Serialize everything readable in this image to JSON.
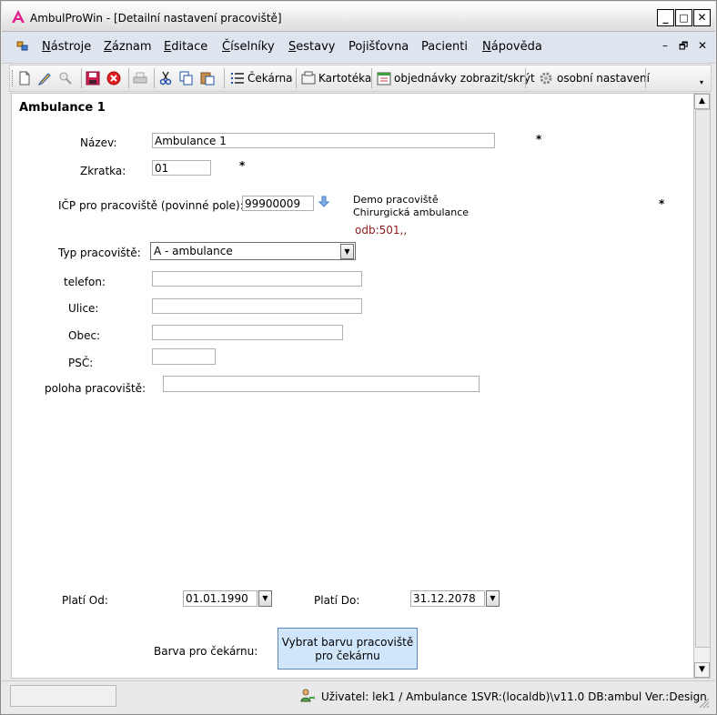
{
  "window": {
    "title": "AmbulProWin  - [Detailní nastavení pracoviště]",
    "controls": {
      "minimize": "_",
      "maximize": "□",
      "close": "✕"
    }
  },
  "menu": {
    "items": [
      {
        "first": "N",
        "rest": "ástroje"
      },
      {
        "first": "Z",
        "rest": "áznam"
      },
      {
        "first": "E",
        "rest": "ditace"
      },
      {
        "first": "Č",
        "rest": "íselníky"
      },
      {
        "first": "S",
        "rest": "estavy"
      },
      {
        "first": "",
        "rest": "Pojišťovna"
      },
      {
        "first": "",
        "rest": "Pacienti"
      },
      {
        "first": "N",
        "rest": "ápověda"
      }
    ],
    "mdi_minimize": "–",
    "mdi_restore": "🗗",
    "mdi_close": "✕"
  },
  "toolbar": {
    "cekarna": "Čekárna",
    "kartoteka": "Kartotéka",
    "objednavky": "objednávky zobrazit/skrýt",
    "nastaveni": "osobní nastavení"
  },
  "form": {
    "heading": "Ambulance 1",
    "nazev_label": "Název:",
    "nazev_value": "Ambulance 1",
    "zkratka_label": "Zkratka:",
    "zkratka_value": "01",
    "icp_label": "IČP pro pracoviště (povinné pole):",
    "icp_value": "99900009",
    "icp_info_line1": "Demo pracoviště",
    "icp_info_line2": "Chirurgická ambulance",
    "icp_odb": "odb:501,,",
    "required_mark": "*",
    "typ_label": "Typ pracoviště:",
    "typ_value": "A - ambulance",
    "telefon_label": "telefon:",
    "telefon_value": "",
    "ulice_label": "Ulice:",
    "ulice_value": "",
    "obec_label": "Obec:",
    "obec_value": "",
    "psc_label": "PSČ:",
    "psc_value": "",
    "poloha_label": "poloha pracoviště:",
    "poloha_value": "",
    "plati_od_label": "Platí Od:",
    "plati_od_value": "01.01.1990",
    "plati_do_label": "Platí Do:",
    "plati_do_value": "31.12.2078",
    "barva_label": "Barva pro čekárnu:",
    "barva_button": "Vybrat barvu pracoviště pro čekárnu"
  },
  "status": {
    "user": "Uživatel: lek1 / Ambulance 1",
    "server": "SVR:(localdb)\\v11.0 DB:ambul Ver.:Design"
  },
  "colors": {
    "menubar": "#dfe5ef",
    "button_fill": "#d0e6fb",
    "odb_text": "#8b1a1a",
    "logo": "#e0208a"
  }
}
